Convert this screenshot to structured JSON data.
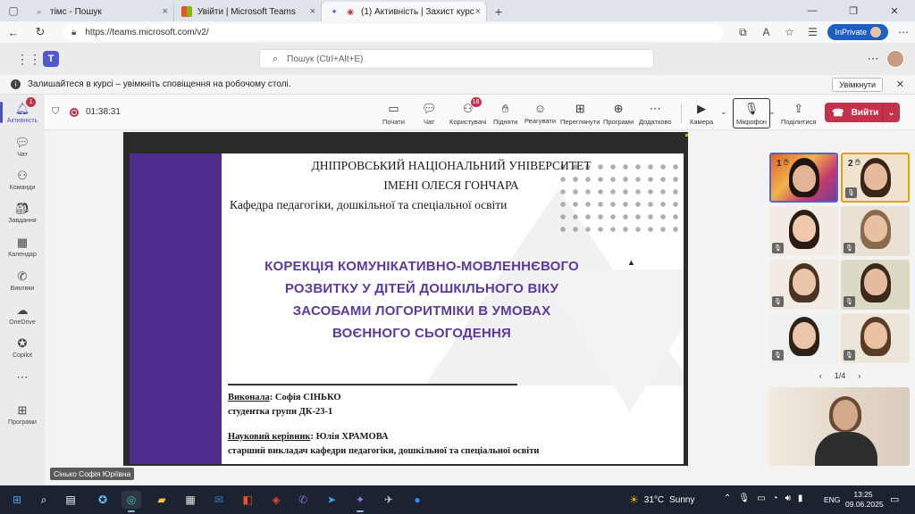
{
  "browser": {
    "tabs": [
      {
        "label": "тімс - Пошук"
      },
      {
        "label": "Увійти | Microsoft Teams"
      },
      {
        "label": "(1) Активність | Захист курс"
      }
    ],
    "url": "https://teams.microsoft.com/v2/",
    "inprivate_label": "InPrivate"
  },
  "teams": {
    "search_placeholder": "Пошук (Ctrl+Alt+E)",
    "banner": {
      "text": "Залишайтеся в курсі – увімкніть сповіщення на робочому столі.",
      "button": "Увімкнути"
    },
    "rail": [
      {
        "label": "Активність",
        "badge": "1",
        "icon": "bell-icon"
      },
      {
        "label": "Чат",
        "icon": "chat-icon"
      },
      {
        "label": "Команди",
        "icon": "teams-icon"
      },
      {
        "label": "Завдання",
        "icon": "assignments-icon"
      },
      {
        "label": "Календар",
        "icon": "calendar-icon"
      },
      {
        "label": "Виклики",
        "icon": "phone-icon"
      },
      {
        "label": "OneDrive",
        "icon": "cloud-icon"
      },
      {
        "label": "Copilot",
        "icon": "copilot-icon"
      },
      {
        "label": "Програми",
        "icon": "apps-icon"
      }
    ]
  },
  "meeting": {
    "timer": "01:38:31",
    "toolbar": {
      "start": "Почати",
      "chat": "Чат",
      "people": "Користувачі",
      "people_badge": "18",
      "raise": "Підняти",
      "react": "Реагувати",
      "view": "Переглянути",
      "apps": "Програми",
      "more": "Додатково",
      "camera": "Камера",
      "mic": "Мікрофон",
      "share": "Поділитися",
      "leave": "Вийти"
    },
    "presenter_name": "Сінько Софія Юріївна",
    "pager": "1/4",
    "gallery": [
      {
        "num": "1"
      },
      {
        "num": "2"
      }
    ]
  },
  "slide": {
    "university_line1": "ДНІПРОВСЬКИЙ НАЦІОНАЛЬНИЙ УНІВЕРСИТЕТ",
    "university_line2": "ІМЕНІ ОЛЕСЯ ГОНЧАРА",
    "department": "Кафедра педагогіки, дошкільної та спеціальної освіти",
    "title_lines": [
      "КОРЕКЦІЯ КОМУНІКАТИВНО-МОВЛЕННЄВОГО",
      "РОЗВИТКУ У ДІТЕЙ ДОШКІЛЬНОГО ВІКУ",
      "ЗАСОБАМИ ЛОГОРИТМІКИ В УМОВАХ",
      "ВОЄННОГО СЬОГОДЕННЯ"
    ],
    "author_label": "Виконала",
    "author_name": ": Софія СІНЬКО",
    "author_group": "студентка групи ДК-23-1",
    "supervisor_label": "Науковий керівник",
    "supervisor_name": ": Юлія ХРАМОВА",
    "supervisor_position": "старший викладач кафедри педагогіки, дошкільної та спеціальної освіти"
  },
  "taskbar": {
    "temperature": "31°C",
    "weather": "Sunny",
    "lang": "ENG",
    "time": "13:25",
    "date": "09.06.2025"
  }
}
